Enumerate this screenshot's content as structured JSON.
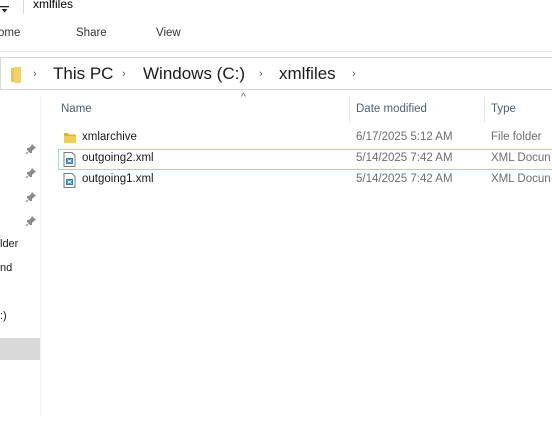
{
  "window": {
    "title": "xmlfiles"
  },
  "ribbon": {
    "tabs": [
      {
        "label": "ome"
      },
      {
        "label": "Share"
      },
      {
        "label": "View"
      }
    ]
  },
  "address": {
    "crumbs": [
      "This PC",
      "Windows (C:)",
      "xmlfiles"
    ]
  },
  "nav": {
    "items": [
      {
        "label": "lder"
      },
      {
        "label": "nd"
      },
      {
        "label": ":)"
      }
    ]
  },
  "list": {
    "columns": {
      "name": "Name",
      "date": "Date modified",
      "type": "Type"
    },
    "rows": [
      {
        "name": "xmlarchive",
        "date": "6/17/2025 5:12 AM",
        "type": "File folder",
        "icon": "folder-icon"
      },
      {
        "name": "outgoing2.xml",
        "date": "5/14/2025 7:42 AM",
        "type": "XML Docun",
        "icon": "xml-file-icon"
      },
      {
        "name": "outgoing1.xml",
        "date": "5/14/2025 7:42 AM",
        "type": "XML Docun",
        "icon": "xml-file-icon"
      }
    ]
  },
  "colors": {
    "selection_border": "#99d1ff",
    "folder": "#dcb43a",
    "header_text": "#4c607a"
  }
}
